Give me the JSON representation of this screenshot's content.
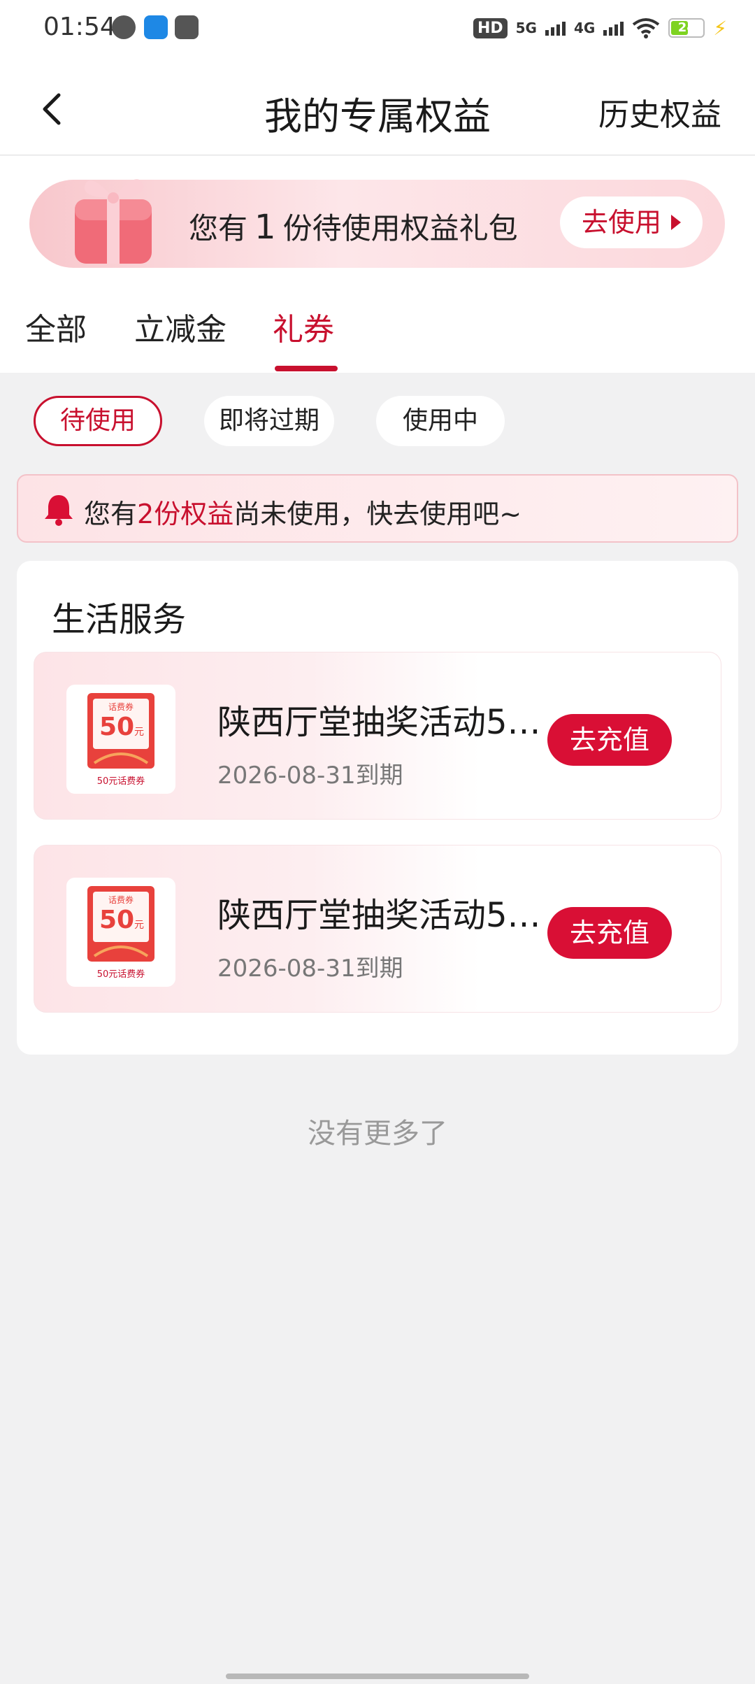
{
  "status_bar": {
    "time": "01:54",
    "hd_label": "HD",
    "network_1": "5G",
    "network_2": "4G",
    "battery": "24",
    "icons": [
      "message-icon",
      "app-icon",
      "sms-icon",
      "wifi-icon",
      "battery-icon",
      "charging-icon"
    ]
  },
  "header": {
    "title": "我的专属权益",
    "history_label": "历史权益"
  },
  "banner": {
    "prefix": "您有",
    "count": "1",
    "suffix": "份待使用权益礼包",
    "button_label": "去使用"
  },
  "tabs": [
    {
      "label": "全部"
    },
    {
      "label": "立减金"
    },
    {
      "label": "礼券",
      "active": true
    }
  ],
  "filters": [
    {
      "label": "待使用",
      "active": true
    },
    {
      "label": "即将过期"
    },
    {
      "label": "使用中"
    }
  ],
  "notice": {
    "prefix": "您有",
    "highlight": "2份权益",
    "suffix": "尚未使用，快去使用吧~"
  },
  "section": {
    "title": "生活服务",
    "coupons": [
      {
        "title": "陕西厅堂抽奖活动5…",
        "expiry": "2026-08-31到期",
        "button_label": "去充值",
        "image": {
          "top": "话费券",
          "amount": "50",
          "unit": "元",
          "caption": "50元话费券"
        }
      },
      {
        "title": "陕西厅堂抽奖活动5…",
        "expiry": "2026-08-31到期",
        "button_label": "去充值",
        "image": {
          "top": "话费券",
          "amount": "50",
          "unit": "元",
          "caption": "50元话费券"
        }
      }
    ]
  },
  "footer": {
    "no_more": "没有更多了"
  },
  "colors": {
    "accent": "#c8102e",
    "button_red": "#d90f35",
    "page_bg": "#f1f1f2"
  }
}
